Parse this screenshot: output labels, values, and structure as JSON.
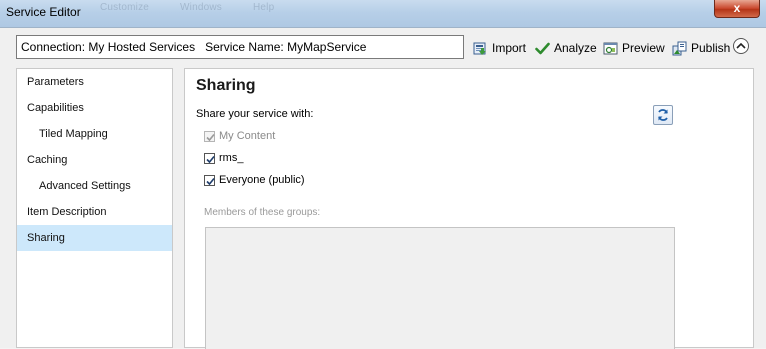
{
  "window": {
    "title": "Service Editor",
    "close_label": "x",
    "background_menu": [
      "Customize",
      "Windows",
      "Help"
    ]
  },
  "connection": {
    "connection_text": "Connection: My Hosted Services",
    "service_text": "Service Name: MyMapService"
  },
  "toolbar": {
    "import_label": "Import",
    "analyze_label": "Analyze",
    "preview_label": "Preview",
    "publish_label": "Publish",
    "collapse_icon": "chevron-up-icon"
  },
  "nav": {
    "items": [
      {
        "label": "Parameters"
      },
      {
        "label": "Capabilities"
      },
      {
        "label": "Tiled Mapping"
      },
      {
        "label": "Caching"
      },
      {
        "label": "Advanced Settings"
      },
      {
        "label": "Item Description"
      },
      {
        "label": "Sharing"
      }
    ],
    "active": "Sharing",
    "active_color": "#cde8fb"
  },
  "sharing": {
    "heading": "Sharing",
    "share_label": "Share your service with:",
    "options": [
      {
        "label": "My Content",
        "checked": true,
        "disabled": true
      },
      {
        "label": "rms_",
        "checked": true,
        "disabled": false
      },
      {
        "label": "Everyone (public)",
        "checked": true,
        "disabled": false
      }
    ],
    "members_label": "Members of these groups:",
    "refresh_icon": "refresh-icon"
  }
}
